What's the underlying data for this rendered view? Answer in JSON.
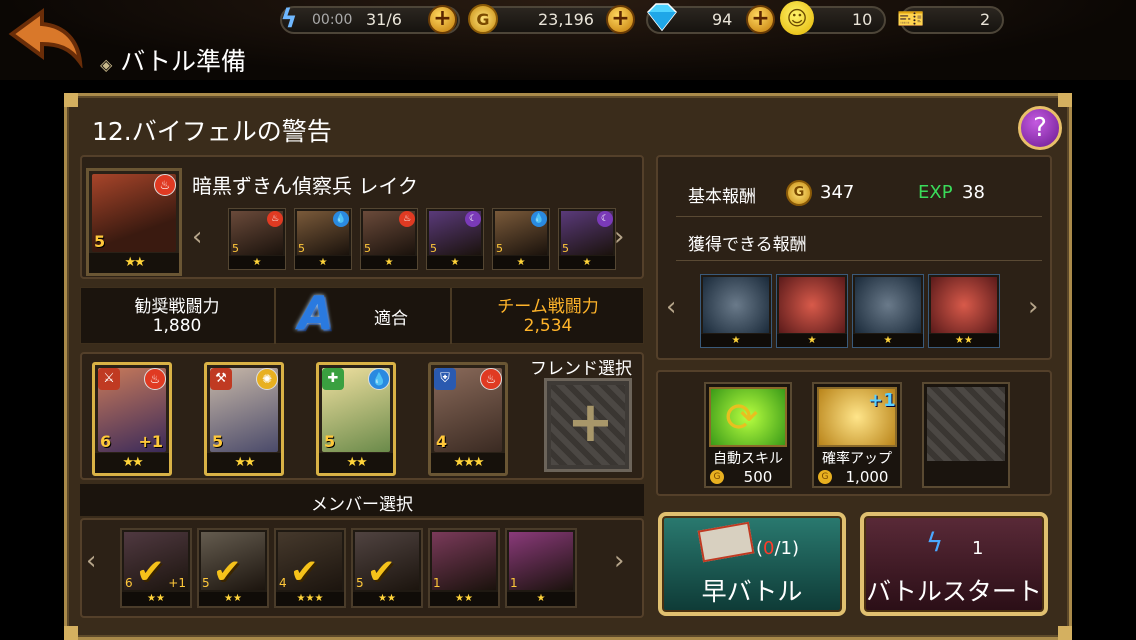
{
  "header": {
    "title": "バトル準備",
    "stamina": {
      "timer": "00:00",
      "value": "31/6"
    },
    "gold": "23,196",
    "gems": "94",
    "friend_points": "10",
    "tickets": "2"
  },
  "stage": {
    "title": "12.バイフェルの警告"
  },
  "enemy": {
    "name": "暗黒ずきん偵察兵 レイク",
    "leader": {
      "level": "5",
      "stars": "★★",
      "element": "fire"
    },
    "list": [
      {
        "level": "5",
        "stars": "★",
        "element": "fire"
      },
      {
        "level": "5",
        "stars": "★",
        "element": "water"
      },
      {
        "level": "5",
        "stars": "★",
        "element": "fire"
      },
      {
        "level": "5",
        "stars": "★",
        "element": "dark"
      },
      {
        "level": "5",
        "stars": "★",
        "element": "water"
      },
      {
        "level": "5",
        "stars": "★",
        "element": "dark"
      }
    ]
  },
  "power": {
    "recommended_label": "勧奨戦闘力",
    "recommended_value": "1,880",
    "rank": "A",
    "rank_label": "適合",
    "team_label": "チーム戦闘力",
    "team_value": "2,534"
  },
  "party": {
    "friend_label": "フレンド選択",
    "member_label": "メンバー選択",
    "units": [
      {
        "level": "6",
        "plus": "+1",
        "stars": "★★",
        "element": "fire"
      },
      {
        "level": "5",
        "plus": "",
        "stars": "★★",
        "element": "light"
      },
      {
        "level": "5",
        "plus": "",
        "stars": "★★",
        "element": "water"
      },
      {
        "level": "4",
        "plus": "",
        "stars": "★★★",
        "element": "fire"
      }
    ]
  },
  "members": [
    {
      "level": "6",
      "plus": "+1",
      "stars": "★★",
      "checked": true
    },
    {
      "level": "5",
      "plus": "",
      "stars": "★★",
      "checked": true
    },
    {
      "level": "4",
      "plus": "",
      "stars": "★★★",
      "checked": true
    },
    {
      "level": "5",
      "plus": "",
      "stars": "★★",
      "checked": true
    },
    {
      "level": "1",
      "plus": "",
      "stars": "★★",
      "checked": false
    },
    {
      "level": "1",
      "plus": "",
      "stars": "★",
      "checked": false
    }
  ],
  "rewards": {
    "base_label": "基本報酬",
    "gold": "347",
    "exp_label": "EXP",
    "exp": "38",
    "obtainable_label": "獲得できる報酬",
    "items": [
      {
        "stars": "★"
      },
      {
        "stars": "★"
      },
      {
        "stars": "★"
      },
      {
        "stars": "★★"
      }
    ]
  },
  "options": {
    "auto_skill_label": "自動スキル",
    "auto_skill_cost": "500",
    "rate_up_label": "確率アップ",
    "rate_up_badge": "+1",
    "rate_up_cost": "1,000"
  },
  "buttons": {
    "quick_battle_label": "早バトル",
    "quick_battle_used": "0",
    "quick_battle_total": "/1)",
    "quick_battle_open": "(",
    "battle_start_label": "バトルスタート",
    "battle_start_cost": "1"
  },
  "colors": {
    "gold_border": "#d9b246",
    "exp_green": "#3adb5a",
    "red_count": "#ff3b2a"
  }
}
